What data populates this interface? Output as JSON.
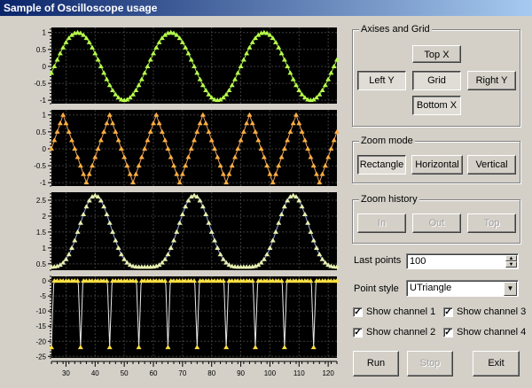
{
  "window": {
    "title": "Sample of Oscilloscope usage"
  },
  "groups": {
    "axes": {
      "label": "Axises and Grid",
      "top": "Top X",
      "left": "Left Y",
      "grid": "Grid",
      "right": "Right Y",
      "bottom": "Bottom X"
    },
    "zoom_mode": {
      "label": "Zoom mode",
      "rectangle": "Rectangle",
      "horizontal": "Horizontal",
      "vertical": "Vertical"
    },
    "zoom_history": {
      "label": "Zoom history",
      "in": "In",
      "out": "Out",
      "top": "Top"
    }
  },
  "last_points": {
    "label": "Last points",
    "value": "100"
  },
  "point_style": {
    "label": "Point style",
    "value": "UTriangle"
  },
  "channels": [
    {
      "label": "Show channel 1",
      "checked": true
    },
    {
      "label": "Show channel 2",
      "checked": true
    },
    {
      "label": "Show channel 3",
      "checked": true
    },
    {
      "label": "Show channel 4",
      "checked": true
    }
  ],
  "actions": {
    "run": "Run",
    "stop": "Stop",
    "exit": "Exit"
  },
  "chart_data": [
    {
      "type": "line",
      "name_visible": false,
      "color": "#a6e84a",
      "marker_color": "#b7ff4a",
      "x_range": [
        25,
        123
      ],
      "ylim": [
        -1.1,
        1.15
      ],
      "yticks": [
        1,
        0.5,
        0,
        -0.5,
        -1
      ],
      "yticklabels": [
        "1",
        "0.5",
        "0",
        "-0.5",
        "-1"
      ],
      "grid": true,
      "wave": "sin",
      "period": 32,
      "amplitude": 1,
      "offset": 0,
      "phase": 34
    },
    {
      "type": "line",
      "name_visible": false,
      "color": "#e8a060",
      "marker_color": "#ffb040",
      "x_range": [
        25,
        123
      ],
      "ylim": [
        -1.1,
        1.15
      ],
      "yticks": [
        1,
        0.5,
        0,
        -0.5,
        -1
      ],
      "yticklabels": [
        "1",
        "0.5",
        "0",
        "-0.5",
        "-1"
      ],
      "grid": true,
      "wave": "triangle",
      "period": 16,
      "amplitude": 1,
      "offset": 0,
      "phase": 29
    },
    {
      "type": "line",
      "name_visible": false,
      "color": "#8fa8e0",
      "marker_color": "#e8f0b0",
      "x_range": [
        25,
        123
      ],
      "ylim": [
        0.3,
        2.75
      ],
      "yticks": [
        2.5,
        2,
        1.5,
        1,
        0.5
      ],
      "yticklabels": [
        "2.5",
        "2",
        "1.5",
        "1",
        "0.5"
      ],
      "grid": true,
      "wave": "bell",
      "period": 34,
      "amplitude": 2.25,
      "offset": 0.4,
      "phase": 40
    },
    {
      "type": "line",
      "name_visible": false,
      "color": "#e8e8e8",
      "marker_color": "#ffe040",
      "x_range": [
        25,
        123
      ],
      "ylim": [
        -25.5,
        1.5
      ],
      "yticks": [
        0,
        -5,
        -10,
        -15,
        -20,
        -25
      ],
      "yticklabels": [
        "0",
        "-5",
        "-10",
        "-15",
        "-20",
        "-25"
      ],
      "grid": true,
      "wave": "spike",
      "period": 10,
      "amplitude": 22,
      "offset": 0,
      "phase": 30
    }
  ],
  "x_axis": {
    "ticks": [
      30,
      40,
      50,
      60,
      70,
      80,
      90,
      100,
      110,
      120
    ],
    "ticklabels": [
      "30",
      "40",
      "50",
      "60",
      "70",
      "80",
      "90",
      "100",
      "110",
      "120"
    ]
  }
}
